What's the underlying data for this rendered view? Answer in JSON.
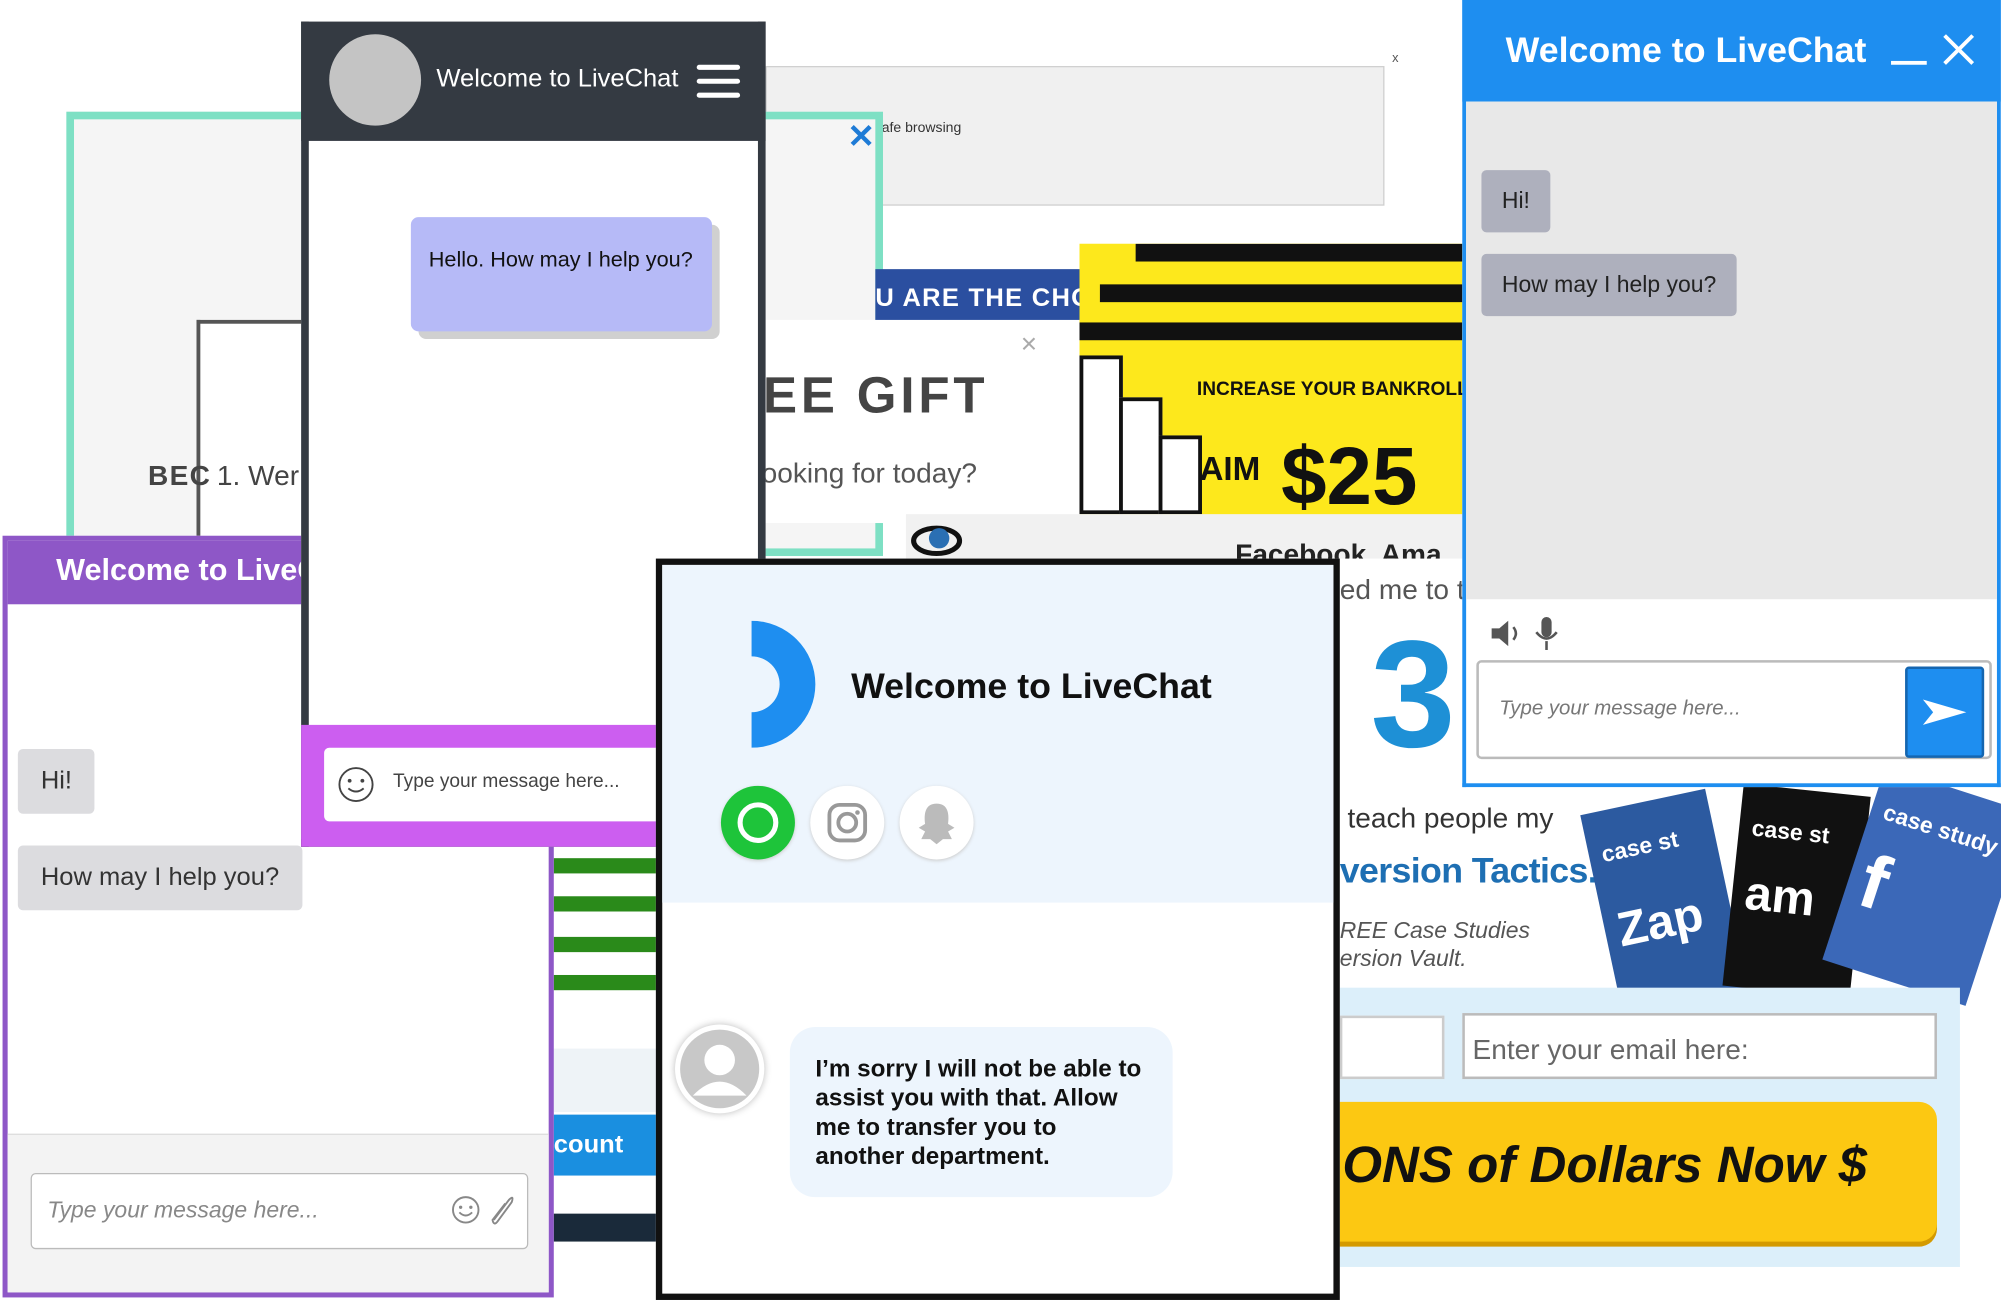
{
  "background": {
    "gray_ad_text": "afe browsing",
    "gray_ad_close": "x",
    "teal_close": "✕",
    "bec_text": "BEC",
    "were_text": "1. Wer",
    "blue_banner": "U ARE THE CHO",
    "gift_close": "×",
    "gift_title": "EE GIFT",
    "gift_question": "looking for today?",
    "bankroll": "INCREASE YOUR BANKROLL",
    "aim": "AIM",
    "amount": "$25",
    "fb_text": "Facebook, Ama",
    "med_me": "ed me to t",
    "big_number": "3",
    "teach": "teach people my",
    "version": "version Tactics.",
    "free_cs_1": "REE Case Studies",
    "free_cs_2": "ersion Vault.",
    "card1_label": "case st",
    "card1_brand": "Zap",
    "card2_label": "case st",
    "card2_brand": "am",
    "card3_label": "case study",
    "card3_brand": "f",
    "email_placeholder": "Enter your email here:",
    "cta": "ONS of Dollars Now $",
    "account_button": "count"
  },
  "purple_widget": {
    "title": "Welcome to LiveC",
    "bubble_hi": "Hi!",
    "bubble_help": "How may I help you?",
    "input_placeholder": "Type your message here..."
  },
  "dark_widget": {
    "title": "Welcome to LiveChat",
    "message": "Hello. How may I help you?",
    "input_placeholder": "Type your message here...",
    "send_arrow": "➜"
  },
  "light_widget": {
    "title": "Welcome to LiveChat",
    "message": "I’m sorry I will not be able to assist you with that. Allow me to transfer you to another department."
  },
  "blue_widget": {
    "title": "Welcome to LiveChat",
    "bubble_hi": "Hi!",
    "bubble_help": "How may I help you?",
    "input_placeholder": "Type your message here..."
  },
  "colors": {
    "purple": "#8e57c7",
    "dark": "#343a42",
    "lilac_bubble": "#b6baf7",
    "magenta_footer": "#cc5ef0",
    "blue": "#1e8ef0",
    "teal": "#7ee0c4",
    "yellow": "#fde81c"
  }
}
